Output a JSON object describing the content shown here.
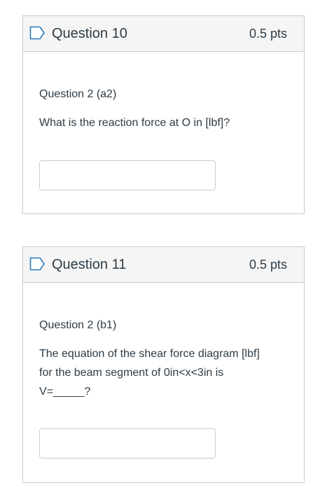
{
  "questions": [
    {
      "title": "Question 10",
      "points": "0.5 pts",
      "label": "Question 2 (a2)",
      "prompt_lines": [
        "What is the reaction force at O in [lbf]?"
      ],
      "answer_value": ""
    },
    {
      "title": "Question 11",
      "points": "0.5 pts",
      "label": "Question 2 (b1)",
      "prompt_lines": [
        "The equation of the shear force diagram [lbf]",
        "for the beam segment of 0in<x<3in is",
        "V=_____?"
      ],
      "answer_value": ""
    }
  ],
  "colors": {
    "header_bg": "#f5f5f5",
    "border": "#c7cdd1",
    "text": "#2d3b45",
    "flag_outline": "#2b7abc"
  },
  "icons": {
    "flag": "bookmark-flag-icon"
  }
}
